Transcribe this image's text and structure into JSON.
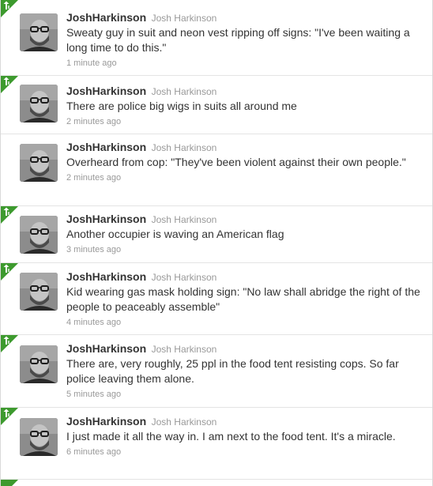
{
  "tweets": [
    {
      "screen_name": "JoshHarkinson",
      "full_name": "Josh Harkinson",
      "text": "Sweaty guy in suit and neon vest ripping off signs: \"I've been waiting a long time to do this.\"",
      "time": "1 minute ago"
    },
    {
      "screen_name": "JoshHarkinson",
      "full_name": "Josh Harkinson",
      "text": "There are police big wigs in suits all around me",
      "time": "2 minutes ago"
    },
    {
      "screen_name": "JoshHarkinson",
      "full_name": "Josh Harkinson",
      "text": "Overheard from cop: \"They've been violent against their own people.\"",
      "time": "2 minutes ago"
    },
    {
      "screen_name": "JoshHarkinson",
      "full_name": "Josh Harkinson",
      "text": "Another occupier is waving an American flag",
      "time": "3 minutes ago"
    },
    {
      "screen_name": "JoshHarkinson",
      "full_name": "Josh Harkinson",
      "text": "Kid wearing gas mask holding sign: \"No law shall abridge the right of the people to peaceably assemble\"",
      "time": "4 minutes ago"
    },
    {
      "screen_name": "JoshHarkinson",
      "full_name": "Josh Harkinson",
      "text": "There are, very roughly, 25 ppl in the food tent resisting cops. So far police leaving them alone.",
      "time": "5 minutes ago"
    },
    {
      "screen_name": "JoshHarkinson",
      "full_name": "Josh Harkinson",
      "text": "I just made it all the way in. I am next to the food tent. It's a miracle.",
      "time": "6 minutes ago"
    }
  ],
  "icons": {
    "corner": "retweet-corner-icon",
    "avatar": "avatar"
  },
  "colors": {
    "corner_green": "#3d9a2e",
    "text": "#333333",
    "meta": "#999999",
    "divider": "#e4e4e4"
  }
}
